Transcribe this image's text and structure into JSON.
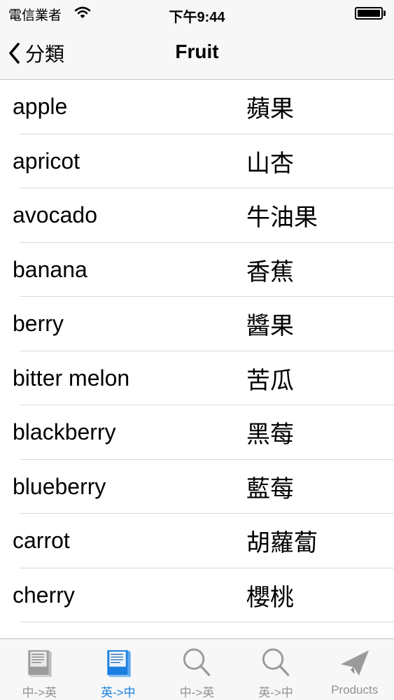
{
  "status_bar": {
    "carrier": "電信業者",
    "time": "下午9:44",
    "wifi_icon": "wifi-icon",
    "battery_icon": "battery-icon"
  },
  "nav": {
    "back_label": "分類",
    "back_icon": "chevron-left-icon",
    "title": "Fruit"
  },
  "rows": [
    {
      "en": "apple",
      "zh": "蘋果"
    },
    {
      "en": "apricot",
      "zh": "山杏"
    },
    {
      "en": "avocado",
      "zh": "牛油果"
    },
    {
      "en": "banana",
      "zh": "香蕉"
    },
    {
      "en": "berry",
      "zh": "醬果"
    },
    {
      "en": "bitter melon",
      "zh": "苦瓜"
    },
    {
      "en": "blackberry",
      "zh": "黑莓"
    },
    {
      "en": "blueberry",
      "zh": "藍莓"
    },
    {
      "en": "carrot",
      "zh": "胡蘿蔔"
    },
    {
      "en": "cherry",
      "zh": "櫻桃"
    }
  ],
  "tabs": [
    {
      "label": "中->英",
      "icon": "book-icon",
      "active": false
    },
    {
      "label": "英->中",
      "icon": "book-icon",
      "active": true
    },
    {
      "label": "中->英",
      "icon": "search-icon",
      "active": false
    },
    {
      "label": "英->中",
      "icon": "search-icon",
      "active": false
    },
    {
      "label": "Products",
      "icon": "paper-plane-icon",
      "active": false
    }
  ],
  "colors": {
    "accent": "#1a7fe0",
    "inactive_tab": "#929292",
    "bar_background": "#f7f7f7",
    "separator": "#d9d9dc"
  }
}
